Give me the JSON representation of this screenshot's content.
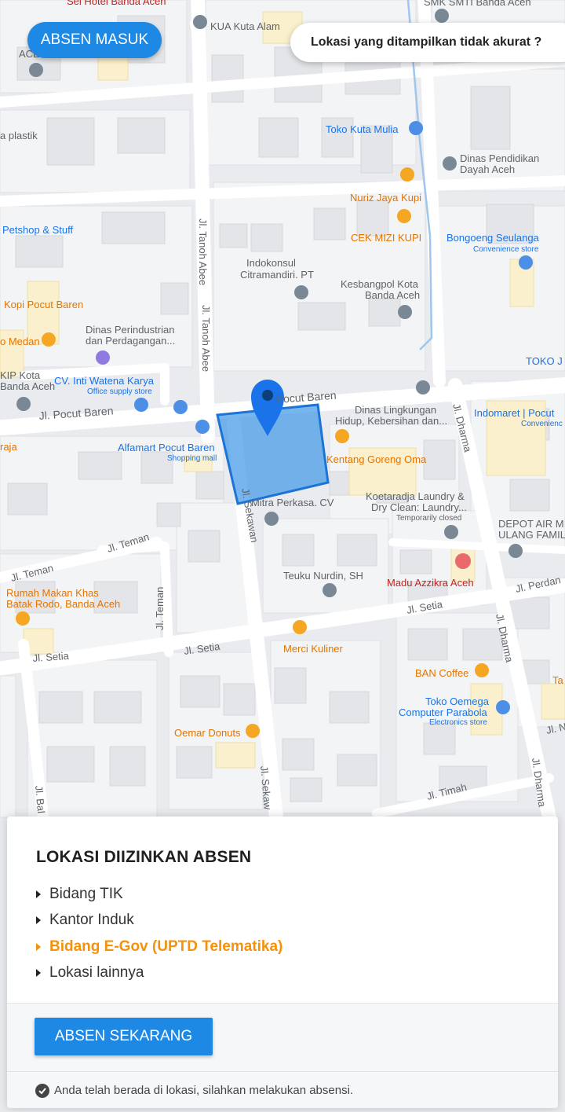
{
  "header": {
    "absen_masuk_label": "ABSEN MASUK",
    "inaccurate_label": "Lokasi yang ditampilkan tidak akurat ?"
  },
  "map": {
    "labels": {
      "smk": "SMK SMTI Banda Aceh",
      "hotel": "Sei Hotel Banda Aceh",
      "kua": "KUA Kuta Alam",
      "ace": "ACE",
      "plastik": "a plastik",
      "toko_kuta_mulia": "Toko Kuta Mulia",
      "dinas_pendidikan_1": "Dinas Pendidikan",
      "dinas_pendidikan_2": "Dayah Aceh",
      "nuriz": "Nuriz Jaya Kupi",
      "cek_mizi": "CEK MIZI KUPI",
      "bongoeng_1": "Bongoeng Seulanga",
      "bongoeng_2": "Convenience store",
      "petshop": "Petshop & Stuff",
      "tanoh_abee_1": "Jl. Tanoh Abee",
      "tanoh_abee_2": "Jl. Tanoh Abee",
      "indokonsul_1": "Indokonsul",
      "indokonsul_2": "Citramandiri. PT",
      "kesbangpol_1": "Kesbangpol Kota",
      "kesbangpol_2": "Banda Aceh",
      "kopi_pocut": "Kopi Pocut Baren",
      "dinas_perin_1": "Dinas Perindustrian",
      "dinas_perin_2": "dan Perdagangan...",
      "o_medan": "o Medan",
      "toko_j": "TOKO J",
      "kip_1": "KIP Kota",
      "kip_2": "Banda Aceh",
      "intiwatena_1": "CV. Inti Watena Karya",
      "intiwatena_2": "Office supply store",
      "pocut_baren_road": "Jl. Pocut Baren",
      "pocut_baren_road_2": "Pocut Baren",
      "dinas_lingk_1": "Dinas Lingkungan",
      "dinas_lingk_2": "Hidup, Kebersihan dan...",
      "dharma_1": "Jl. Dharma",
      "indomaret_1": "Indomaret | Pocut",
      "indomaret_2": "Convenienc",
      "raja": "raja",
      "alfamart_1": "Alfamart Pocut Baren",
      "alfamart_2": "Shopping mall",
      "kentang": "Kentang Goreng Oma",
      "sekawan_1": "Jl. Sekawan",
      "mitra": "Mitra Perkasa. CV",
      "koetaradja_1": "Koetaradja Laundry &",
      "koetaradja_2": "Dry Clean: Laundry...",
      "koetaradja_3": "Temporarily closed",
      "depot_1": "DEPOT AIR M",
      "depot_2": "ULANG FAMIL",
      "teman_1": "Jl. Teman",
      "teman_2": "Jl. Teman",
      "teman_3": "Jl. Teman",
      "teuku": "Teuku Nurdin, SH",
      "madu": "Madu Azzikra Aceh",
      "perdan": "Jl. Perdan",
      "rumah_makan_1": "Rumah Makan Khas",
      "rumah_makan_2": "Batak Rodo, Banda Aceh",
      "setia_1": "Jl. Setia",
      "setia_2": "Jl. Setia",
      "setia_3": "Jl. Setia",
      "merci": "Merci Kuliner",
      "ban_coffee": "BAN Coffee",
      "dharma_2": "Jl. Dharma",
      "ta": "Ta",
      "oemega_1": "Toko Oemega",
      "oemega_2": "Computer Parabola",
      "oemega_3": "Electronics store",
      "oemar": "Oemar Donuts",
      "sekawan_2": "Jl. Sekaw",
      "timah": "Jl. Timah",
      "dharma_3": "Jl. Dharma",
      "jl_n": "Jl. N",
      "bal": "Jl. Bal"
    }
  },
  "panel": {
    "title": "LOKASI DIIZINKAN ABSEN",
    "locations": [
      {
        "label": "Bidang TIK",
        "active": false
      },
      {
        "label": "Kantor Induk",
        "active": false
      },
      {
        "label": "Bidang E-Gov (UPTD Telematika)",
        "active": true
      },
      {
        "label": "Lokasi lainnya",
        "active": false
      }
    ],
    "submit_label": "ABSEN SEKARANG",
    "status_text": "Anda telah berada di lokasi, silahkan melakukan absensi."
  },
  "colors": {
    "primary": "#1e88e5",
    "active_location": "#f5920b",
    "geofence": "#4a9ce8",
    "poi_blue": "#1a73e8",
    "poi_orange": "#e37400"
  }
}
